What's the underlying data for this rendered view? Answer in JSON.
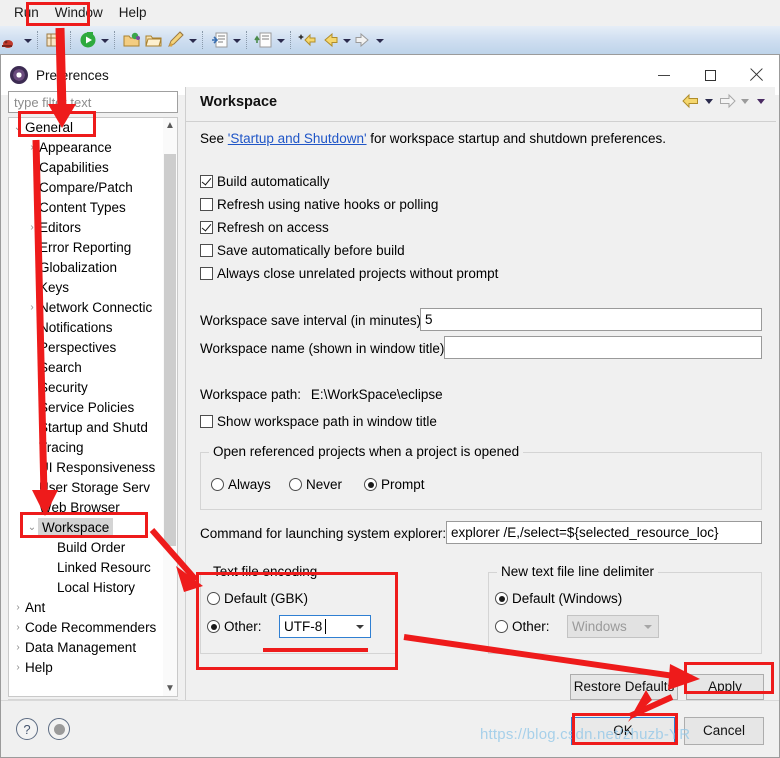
{
  "menubar": {
    "items": [
      {
        "label": "Run"
      },
      {
        "label": "Window"
      },
      {
        "label": "Help"
      }
    ]
  },
  "dialog": {
    "title": "Preferences",
    "window_controls": {
      "minimize": "minimize-icon",
      "maximize": "maximize-icon",
      "close": "close-icon"
    }
  },
  "filter": {
    "placeholder": "type filter text",
    "value": ""
  },
  "tree": {
    "items": [
      {
        "label": "General",
        "indent": 0,
        "twisty": "down",
        "selected": false,
        "boxed": true
      },
      {
        "label": "Appearance",
        "indent": 1,
        "twisty": "right",
        "selected": false
      },
      {
        "label": "Capabilities",
        "indent": 1,
        "twisty": "",
        "selected": false
      },
      {
        "label": "Compare/Patch",
        "indent": 1,
        "twisty": "",
        "selected": false
      },
      {
        "label": "Content Types",
        "indent": 1,
        "twisty": "",
        "selected": false
      },
      {
        "label": "Editors",
        "indent": 1,
        "twisty": "right",
        "selected": false
      },
      {
        "label": "Error Reporting",
        "indent": 1,
        "twisty": "",
        "selected": false
      },
      {
        "label": "Globalization",
        "indent": 1,
        "twisty": "",
        "selected": false
      },
      {
        "label": "Keys",
        "indent": 1,
        "twisty": "",
        "selected": false
      },
      {
        "label": "Network Connectic",
        "indent": 1,
        "twisty": "right",
        "selected": false
      },
      {
        "label": "Notifications",
        "indent": 1,
        "twisty": "",
        "selected": false
      },
      {
        "label": "Perspectives",
        "indent": 1,
        "twisty": "",
        "selected": false
      },
      {
        "label": "Search",
        "indent": 1,
        "twisty": "",
        "selected": false
      },
      {
        "label": "Security",
        "indent": 1,
        "twisty": "",
        "selected": false
      },
      {
        "label": "Service Policies",
        "indent": 1,
        "twisty": "",
        "selected": false
      },
      {
        "label": "Startup and Shutd",
        "indent": 1,
        "twisty": "",
        "selected": false
      },
      {
        "label": "Tracing",
        "indent": 1,
        "twisty": "",
        "selected": false
      },
      {
        "label": "UI Responsiveness",
        "indent": 1,
        "twisty": "",
        "selected": false
      },
      {
        "label": "User Storage Serv",
        "indent": 1,
        "twisty": "",
        "selected": false
      },
      {
        "label": "Web Browser",
        "indent": 1,
        "twisty": "",
        "selected": false
      },
      {
        "label": "Workspace",
        "indent": 1,
        "twisty": "down",
        "selected": true,
        "boxed": true
      },
      {
        "label": "Build Order",
        "indent": 2,
        "twisty": "",
        "selected": false
      },
      {
        "label": "Linked Resourc",
        "indent": 2,
        "twisty": "",
        "selected": false
      },
      {
        "label": "Local History",
        "indent": 2,
        "twisty": "",
        "selected": false
      },
      {
        "label": "Ant",
        "indent": 0,
        "twisty": "right",
        "selected": false
      },
      {
        "label": "Code Recommenders",
        "indent": 0,
        "twisty": "right",
        "selected": false
      },
      {
        "label": "Data Management",
        "indent": 0,
        "twisty": "right",
        "selected": false
      },
      {
        "label": "Help",
        "indent": 0,
        "twisty": "right",
        "selected": false
      }
    ]
  },
  "page": {
    "title": "Workspace",
    "description_prefix": "See ",
    "description_link": "'Startup and Shutdown'",
    "description_suffix": " for workspace startup and shutdown preferences.",
    "checkboxes": [
      {
        "label": "Build automatically",
        "checked": true,
        "mnemonic": "B"
      },
      {
        "label": "Refresh using native hooks or polling",
        "checked": false,
        "mnemonic": "R"
      },
      {
        "label": "Refresh on access",
        "checked": true,
        "mnemonic": "s"
      },
      {
        "label": "Save automatically before build",
        "checked": false,
        "mnemonic": "m"
      },
      {
        "label": "Always close unrelated projects without prompt",
        "checked": false,
        "mnemonic": "c"
      }
    ],
    "save_interval_label": "Workspace save interval (in minutes):",
    "save_interval_value": "5",
    "workspace_name_label": "Workspace name (shown in window title):",
    "workspace_name_value": "",
    "workspace_path_label": "Workspace path:",
    "workspace_path_value": "E:\\WorkSpace\\eclipse",
    "show_path_checkbox": {
      "label": "Show workspace path in window title",
      "checked": false
    },
    "open_referenced_group": {
      "title": "Open referenced projects when a project is opened",
      "options": [
        {
          "label": "Always",
          "selected": false
        },
        {
          "label": "Never",
          "selected": false
        },
        {
          "label": "Prompt",
          "selected": true
        }
      ]
    },
    "explorer_command_label": "Command for launching system explorer:",
    "explorer_command_value": "explorer /E,/select=${selected_resource_loc}",
    "text_file_encoding": {
      "title": "Text file encoding",
      "default_label": "Default (GBK)",
      "default_selected": false,
      "other_label": "Other:",
      "other_selected": true,
      "other_value": "UTF-8"
    },
    "line_delimiter": {
      "title": "New text file line delimiter",
      "default_label": "Default (Windows)",
      "default_selected": true,
      "other_label": "Other:",
      "other_selected": false,
      "other_value": "Windows",
      "other_disabled": true
    },
    "restore_defaults_label": "Restore Defaults",
    "apply_label": "Apply"
  },
  "footer": {
    "ok_label": "OK",
    "cancel_label": "Cancel",
    "help_icon": "question-mark-icon",
    "pin_icon": "circle-dot-icon"
  },
  "watermark": "https://blog.csdn.net/zhuzb-YR",
  "colors": {
    "annotation": "#ee1b1b",
    "link": "#2056c7",
    "accent": "#2f7fd2",
    "selection": "#d4d4d4"
  }
}
